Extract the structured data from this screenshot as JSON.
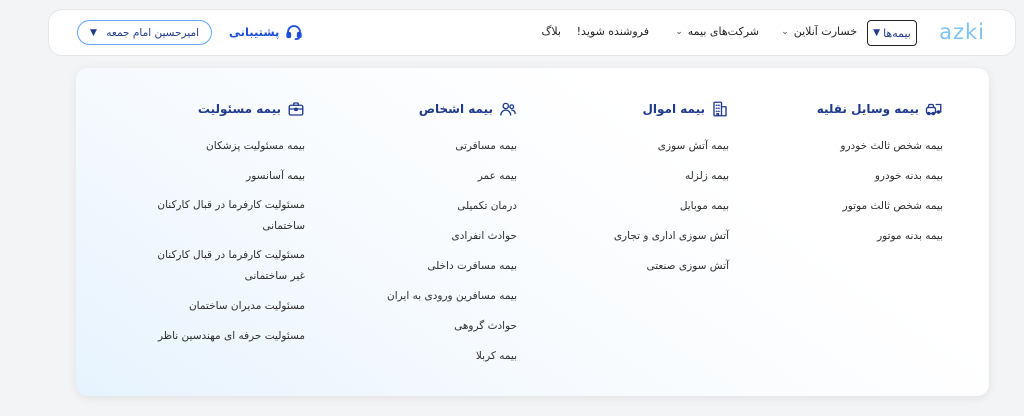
{
  "nav": {
    "logo": "azki",
    "active_label": "بیمه‌ها",
    "items": [
      {
        "label": "خسارت آنلاین",
        "has_chevron": true
      },
      {
        "label": "شرکت‌های بیمه",
        "has_chevron": true
      },
      {
        "label": "فروشنده شوید!",
        "has_chevron": false
      },
      {
        "label": "بلاگ",
        "has_chevron": false
      }
    ],
    "support_label": "پشتیبانی",
    "user_name": "امیرحسین امام جمعه"
  },
  "menu": {
    "columns": [
      {
        "title": "بیمه وسایل نقلیه",
        "icon": "vehicle-icon",
        "items": [
          "بیمه شخص ثالث خودرو",
          "بیمه بدنه خودرو",
          "بیمه شخص ثالث موتور",
          "بیمه بدنه موتور"
        ]
      },
      {
        "title": "بیمه اموال",
        "icon": "building-icon",
        "items": [
          "بیمه آتش سوزی",
          "بیمه زلزله",
          "بیمه موبایل",
          "آتش سوزی اداری و تجاری",
          "آتش سوزی صنعتی"
        ]
      },
      {
        "title": "بیمه اشخاص",
        "icon": "people-icon",
        "items": [
          "بیمه مسافرتی",
          "بیمه عمر",
          "درمان تکمیلی",
          "حوادث انفرادی",
          "بیمه مسافرت داخلی",
          "بیمه مسافرین ورودی به ایران",
          "حوادث گروهی",
          "بیمه کربلا"
        ]
      },
      {
        "title": "بیمه مسئولیت",
        "icon": "briefcase-icon",
        "items": [
          "بیمه مسئولیت پزشکان",
          "بیمه آسانسور",
          "مسئولیت کارفرما در قبال کارکنان ساختمانی",
          "مسئولیت کارفرما در قبال کارکنان غیر ساختمانی",
          "مسئولیت مدیران ساختمان",
          "مسئولیت حرفه ای مهندسین ناظر"
        ]
      }
    ]
  }
}
